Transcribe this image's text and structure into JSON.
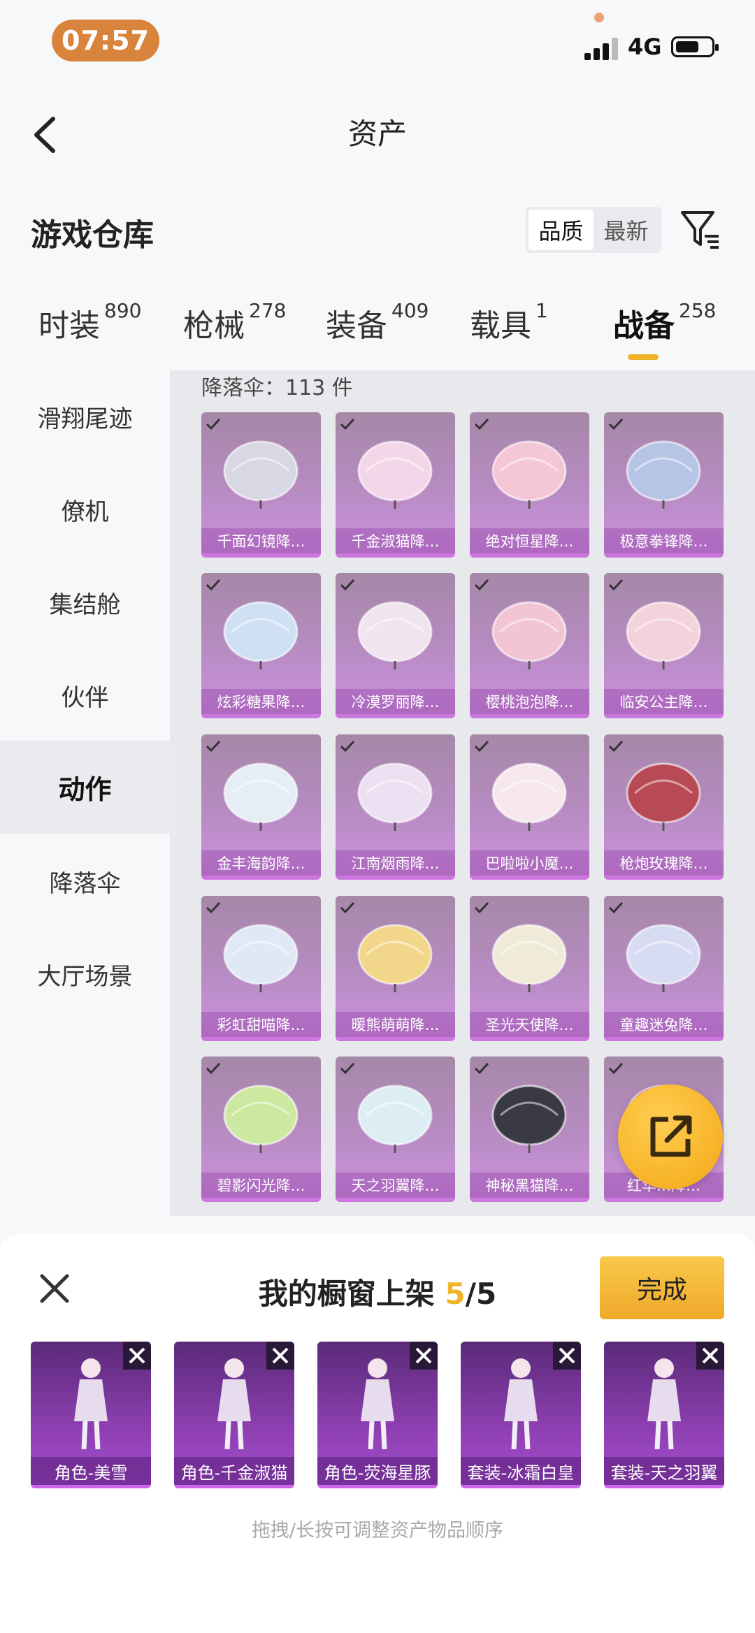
{
  "status_bar": {
    "time": "07:57",
    "network": "4G"
  },
  "header": {
    "title": "资产"
  },
  "section": {
    "title": "游戏仓库",
    "sort_options": [
      "品质",
      "最新"
    ],
    "sort_selected": "品质"
  },
  "tabs": [
    {
      "label": "时装",
      "count": "890"
    },
    {
      "label": "枪械",
      "count": "278"
    },
    {
      "label": "装备",
      "count": "409"
    },
    {
      "label": "载具",
      "count": "1"
    },
    {
      "label": "战备",
      "count": "258",
      "active": true
    }
  ],
  "sidebar": {
    "items": [
      {
        "label": "滑翔尾迹"
      },
      {
        "label": "僚机"
      },
      {
        "label": "集结舱"
      },
      {
        "label": "伙伴"
      },
      {
        "label": "动作",
        "active": true
      },
      {
        "label": "降落伞"
      },
      {
        "label": "大厅场景"
      }
    ]
  },
  "content": {
    "count_line": "降落伞：113 件",
    "items": [
      {
        "name": "千面幻镜降…",
        "art": "diamond-parachute-icon"
      },
      {
        "name": "千金淑猫降…",
        "art": "cat-parachute-icon"
      },
      {
        "name": "绝对恒星降…",
        "art": "pink-parachute-icon"
      },
      {
        "name": "极意拳锋降…",
        "art": "wing-parachute-icon"
      },
      {
        "name": "炫彩糖果降…",
        "art": "candy-parachute-icon"
      },
      {
        "name": "冷漠罗丽降…",
        "art": "lace-parachute-icon"
      },
      {
        "name": "樱桃泡泡降…",
        "art": "cherry-parachute-icon"
      },
      {
        "name": "临安公主降…",
        "art": "princess-parachute-icon"
      },
      {
        "name": "金丰海韵降…",
        "art": "shell-parachute-icon"
      },
      {
        "name": "江南烟雨降…",
        "art": "feather-parachute-icon"
      },
      {
        "name": "巴啦啦小魔…",
        "art": "magic-parachute-icon"
      },
      {
        "name": "枪炮玫瑰降…",
        "art": "rose-parachute-icon"
      },
      {
        "name": "彩虹甜喵降…",
        "art": "rainbow-parachute-icon"
      },
      {
        "name": "暖熊萌萌降…",
        "art": "bear-parachute-icon"
      },
      {
        "name": "圣光天使降…",
        "art": "angel-parachute-icon"
      },
      {
        "name": "童趣迷兔降…",
        "art": "bunny-parachute-icon"
      },
      {
        "name": "碧影闪光降…",
        "art": "green-parachute-icon"
      },
      {
        "name": "天之羽翼降…",
        "art": "wing-dome-parachute-icon"
      },
      {
        "name": "神秘黑猫降…",
        "art": "black-cat-parachute-icon"
      },
      {
        "name": "红华…降…",
        "art": "red-parachute-icon"
      }
    ]
  },
  "showcase": {
    "title_prefix": "我的橱窗上架",
    "current": "5",
    "total": "/5",
    "done_label": "完成",
    "slots": [
      {
        "name": "角色-美雪"
      },
      {
        "name": "角色-千金淑猫"
      },
      {
        "name": "角色-荧海星豚"
      },
      {
        "name": "套装-冰霜白皇"
      },
      {
        "name": "套装-天之羽翼"
      }
    ],
    "hint": "拖拽/长按可调整资产物品顺序"
  },
  "colors": {
    "accent": "#f0b429",
    "card_purple": "#c48fd2",
    "status_pill": "#d9843d"
  }
}
